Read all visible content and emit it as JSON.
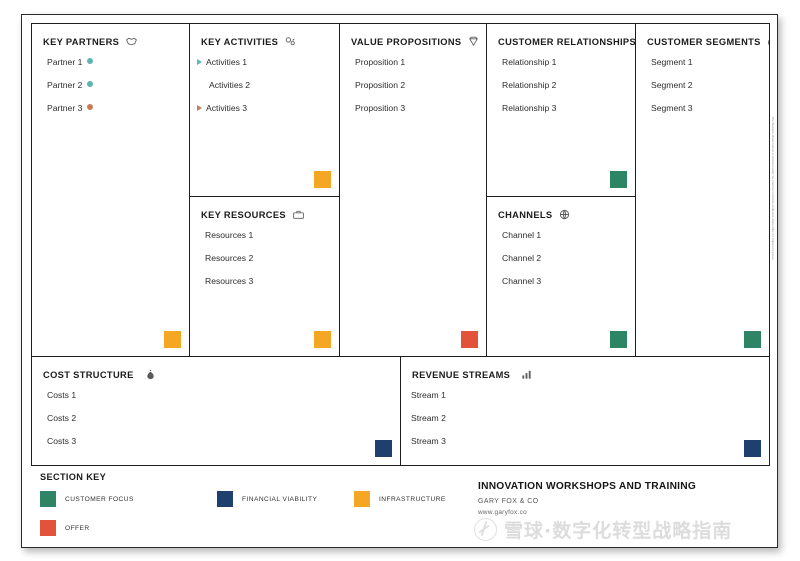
{
  "poster": {
    "attribution": "The Business Model Canvas is licensed under the Creative Commons Attribution-Share Alike 3.0 Unported License"
  },
  "colors": {
    "customer_focus": "#2E8566",
    "financial_viability": "#1F3F6E",
    "infrastructure": "#F5A623",
    "offer": "#E2533A",
    "connector_teal": "#5FB3B0",
    "connector_sienna": "#C97B58",
    "border": "#1d1d1d"
  },
  "blocks": {
    "key_partners": {
      "title": "KEY PARTNERS",
      "icon": "handshake-icon",
      "swatch": "infrastructure",
      "items": [
        "Partner 1",
        "Partner 2",
        "Partner 3"
      ]
    },
    "key_activities": {
      "title": "KEY ACTIVITIES",
      "icon": "gears-icon",
      "swatch": "infrastructure",
      "items": [
        "Activities 1",
        "Activities 2",
        "Activities 3"
      ]
    },
    "key_resources": {
      "title": "KEY RESOURCES",
      "icon": "toolbox-icon",
      "swatch": "infrastructure",
      "items": [
        "Resources 1",
        "Resources 2",
        "Resources 3"
      ]
    },
    "value_propositions": {
      "title": "VALUE PROPOSITIONS",
      "icon": "diamond-icon",
      "swatch": "offer",
      "items": [
        "Proposition 1",
        "Proposition 2",
        "Proposition 3"
      ]
    },
    "customer_relationships": {
      "title": "CUSTOMER RELATIONSHIPS",
      "icon": "heart-icon",
      "swatch": "customer_focus",
      "items": [
        "Relationship 1",
        "Relationship 2",
        "Relationship 3"
      ]
    },
    "channels": {
      "title": "CHANNELS",
      "icon": "truck-icon",
      "swatch": "customer_focus",
      "items": [
        "Channel 1",
        "Channel 2",
        "Channel 3"
      ]
    },
    "customer_segments": {
      "title": "CUSTOMER SEGMENTS",
      "icon": "target-icon",
      "swatch": "customer_focus",
      "items": [
        "Segment 1",
        "Segment 2",
        "Segment 3"
      ]
    },
    "cost_structure": {
      "title": "COST STRUCTURE",
      "icon": "money-bag-icon",
      "swatch": "financial_viability",
      "items": [
        "Costs 1",
        "Costs 2",
        "Costs 3"
      ]
    },
    "revenue_streams": {
      "title": "REVENUE STREAMS",
      "icon": "bar-chart-icon",
      "swatch": "financial_viability",
      "items": [
        "Stream 1",
        "Stream 2",
        "Stream 3"
      ]
    }
  },
  "legend": {
    "title": "SECTION KEY",
    "entries": [
      {
        "label": "CUSTOMER FOCUS",
        "color": "#2E8566"
      },
      {
        "label": "FINANCIAL VIABILITY",
        "color": "#1F3F6E"
      },
      {
        "label": "INFRASTRUCTURE",
        "color": "#F5A623"
      },
      {
        "label": "OFFER",
        "color": "#E2533A"
      }
    ]
  },
  "brand": {
    "title": "INNOVATION WORKSHOPS AND TRAINING",
    "company": "GARY FOX & CO",
    "url": "www.garyfox.co"
  },
  "watermark": {
    "text": "雪球·数字化转型战略指南",
    "logo": "xueqiu-logo-icon"
  }
}
